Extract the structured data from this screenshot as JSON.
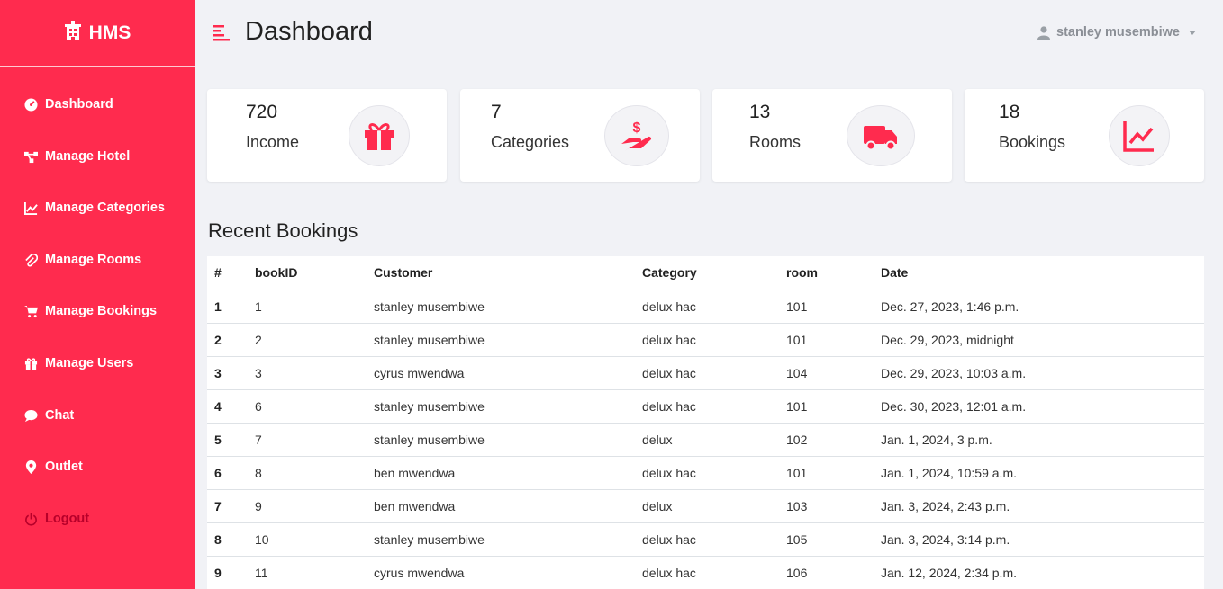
{
  "brand": {
    "name": "HMS"
  },
  "sidebar": {
    "items": [
      {
        "label": "Dashboard",
        "icon": "dashboard-icon"
      },
      {
        "label": "Manage Hotel",
        "icon": "network-icon"
      },
      {
        "label": "Manage Categories",
        "icon": "chart-line-icon"
      },
      {
        "label": "Manage Rooms",
        "icon": "paperclip-icon"
      },
      {
        "label": "Manage Bookings",
        "icon": "cart-icon"
      },
      {
        "label": "Manage Users",
        "icon": "gift-icon"
      },
      {
        "label": "Chat",
        "icon": "chat-icon"
      },
      {
        "label": "Outlet",
        "icon": "map-pin-icon"
      },
      {
        "label": "Logout",
        "icon": "power-icon"
      }
    ]
  },
  "header": {
    "title": "Dashboard",
    "user": "stanley musembiwe"
  },
  "cards": [
    {
      "value": "720",
      "label": "Income",
      "icon": "gift-icon"
    },
    {
      "value": "7",
      "label": "Categories",
      "icon": "hand-dollar-icon"
    },
    {
      "value": "13",
      "label": "Rooms",
      "icon": "truck-icon"
    },
    {
      "value": "18",
      "label": "Bookings",
      "icon": "chart-line-icon"
    }
  ],
  "colors": {
    "accent": "#ff2b4e",
    "background": "#f1f2f6"
  },
  "bookings": {
    "title": "Recent Bookings",
    "columns": [
      "#",
      "bookID",
      "Customer",
      "Category",
      "room",
      "Date"
    ],
    "rows": [
      [
        "1",
        "1",
        "stanley musembiwe",
        "delux hac",
        "101",
        "Dec. 27, 2023, 1:46 p.m."
      ],
      [
        "2",
        "2",
        "stanley musembiwe",
        "delux hac",
        "101",
        "Dec. 29, 2023, midnight"
      ],
      [
        "3",
        "3",
        "cyrus mwendwa",
        "delux hac",
        "104",
        "Dec. 29, 2023, 10:03 a.m."
      ],
      [
        "4",
        "6",
        "stanley musembiwe",
        "delux hac",
        "101",
        "Dec. 30, 2023, 12:01 a.m."
      ],
      [
        "5",
        "7",
        "stanley musembiwe",
        "delux",
        "102",
        "Jan. 1, 2024, 3 p.m."
      ],
      [
        "6",
        "8",
        "ben mwendwa",
        "delux hac",
        "101",
        "Jan. 1, 2024, 10:59 a.m."
      ],
      [
        "7",
        "9",
        "ben mwendwa",
        "delux",
        "103",
        "Jan. 3, 2024, 2:43 p.m."
      ],
      [
        "8",
        "10",
        "stanley musembiwe",
        "delux hac",
        "105",
        "Jan. 3, 2024, 3:14 p.m."
      ],
      [
        "9",
        "11",
        "cyrus mwendwa",
        "delux hac",
        "106",
        "Jan. 12, 2024, 2:34 p.m."
      ]
    ]
  }
}
